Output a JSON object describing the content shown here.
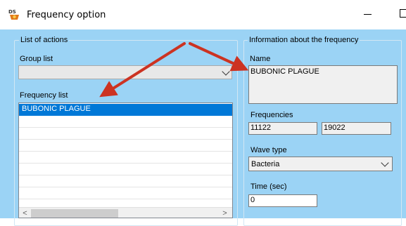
{
  "window": {
    "title": "Frequency option",
    "icon": "app-icon",
    "controls": {
      "minimize": "minimize-icon",
      "maximize": "maximize-icon"
    }
  },
  "actions": {
    "group_title": "List of actions",
    "group_list_label": "Group list",
    "group_list_value": "",
    "frequency_list_label": "Frequency list",
    "frequency_list_items": [
      "BUBONIC PLAGUE"
    ],
    "selected_index": 0
  },
  "info": {
    "group_title": "Information about the frequency",
    "name_label": "Name",
    "name_value": "BUBONIC PLAGUE",
    "frequencies_label": "Frequencies",
    "frequencies": [
      "11122",
      "19022"
    ],
    "wave_type_label": "Wave type",
    "wave_type_value": "Bacteria",
    "time_label": "Time (sec)",
    "time_value": "0"
  },
  "colors": {
    "client_bg": "#9bd3f5",
    "selection": "#0078d7",
    "annotation_arrow": "#cc3322"
  }
}
